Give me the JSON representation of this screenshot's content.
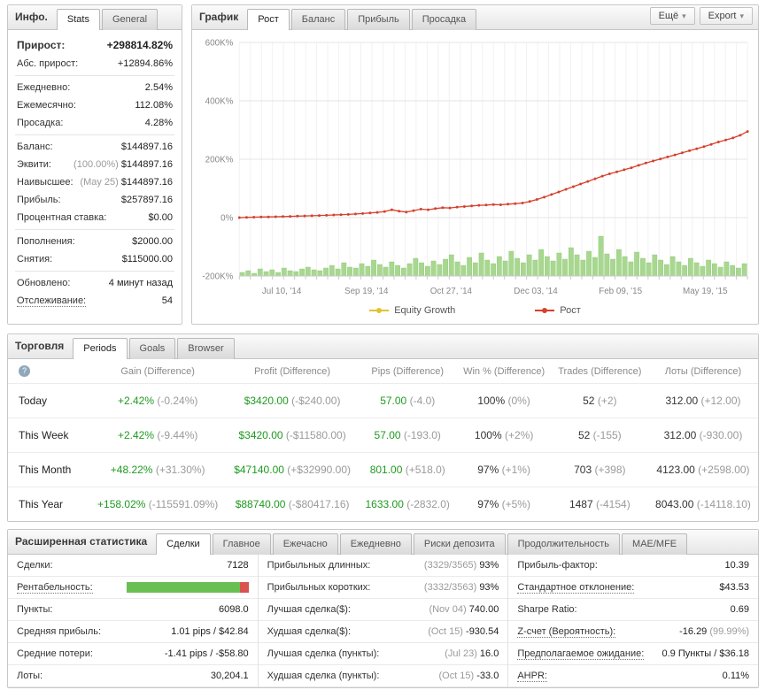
{
  "info": {
    "title": "Инфо.",
    "tabs": [
      "Stats",
      "General"
    ],
    "gain_label": "Прирост:",
    "gain_value": "+298814.82%",
    "abs_gain_label": "Абс. прирост:",
    "abs_gain_value": "+12894.86%",
    "daily_label": "Ежедневно:",
    "daily_value": "2.54%",
    "monthly_label": "Ежемесячно:",
    "monthly_value": "112.08%",
    "drawdown_label": "Просадка:",
    "drawdown_value": "4.28%",
    "balance_label": "Баланс:",
    "balance_value": "$144897.16",
    "equity_label": "Эквити:",
    "equity_pct": "(100.00%)",
    "equity_value": "$144897.16",
    "highest_label": "Наивысшее:",
    "highest_date": "(May 25)",
    "highest_value": "$144897.16",
    "profit_label": "Прибыль:",
    "profit_value": "$257897.16",
    "interest_label": "Процентная ставка:",
    "interest_value": "$0.00",
    "deposits_label": "Пополнения:",
    "deposits_value": "$2000.00",
    "withdrawals_label": "Снятия:",
    "withdrawals_value": "$115000.00",
    "updated_label": "Обновлено:",
    "updated_value": "4 минут назад",
    "tracking_label": "Отслеживание:",
    "tracking_value": "54"
  },
  "chart": {
    "title": "График",
    "tabs": [
      "Рост",
      "Баланс",
      "Прибыль",
      "Просадка"
    ],
    "more_btn": "Ещё",
    "export_btn": "Export",
    "caret": "▾",
    "legend": [
      "Equity Growth",
      "Рост"
    ]
  },
  "chart_data": {
    "type": "line",
    "title": "Рост счёта (%)",
    "xlabel": "",
    "ylabel": "",
    "ylim": [
      -200000,
      600000
    ],
    "yticks": [
      "600K%",
      "400K%",
      "200K%",
      "0%",
      "-200K%"
    ],
    "ytick_values": [
      600000,
      400000,
      200000,
      0,
      -200000
    ],
    "xticks": [
      "Jul 10, '14",
      "Sep 19, '14",
      "Oct 27, '14",
      "Dec 03, '14",
      "Feb 09, '15",
      "May 19, '15"
    ],
    "legend_position": "bottom",
    "series": [
      {
        "name": "Equity Growth",
        "color": "#e3c230",
        "values": []
      },
      {
        "name": "Рост",
        "color": "#d6402c",
        "values": [
          0,
          800,
          1500,
          2000,
          2500,
          3000,
          3500,
          4200,
          5000,
          5800,
          6500,
          7200,
          8000,
          9000,
          10000,
          11000,
          12500,
          14000,
          16000,
          18000,
          21000,
          27000,
          22000,
          19000,
          24000,
          29000,
          27000,
          31000,
          34000,
          33000,
          36000,
          38000,
          40000,
          42000,
          43000,
          45000,
          44000,
          46000,
          48000,
          50000,
          55000,
          62000,
          70000,
          79000,
          88000,
          97000,
          106000,
          115000,
          124000,
          133000,
          142000,
          150000,
          157000,
          164000,
          171000,
          179000,
          187000,
          194000,
          201000,
          208000,
          215000,
          222000,
          229000,
          236000,
          243000,
          251000,
          259000,
          266000,
          273000,
          282000,
          295000
        ]
      }
    ],
    "bars": {
      "name": "volume",
      "color": "#a8d88f",
      "values": [
        4,
        6,
        3,
        8,
        5,
        7,
        4,
        9,
        6,
        5,
        8,
        10,
        7,
        6,
        9,
        12,
        8,
        15,
        10,
        9,
        14,
        11,
        18,
        13,
        10,
        16,
        12,
        9,
        14,
        20,
        15,
        11,
        17,
        13,
        19,
        24,
        16,
        12,
        21,
        15,
        26,
        18,
        14,
        22,
        17,
        28,
        20,
        15,
        24,
        18,
        30,
        22,
        17,
        26,
        19,
        32,
        24,
        18,
        28,
        21,
        45,
        25,
        19,
        30,
        22,
        16,
        27,
        20,
        15,
        24,
        18,
        13,
        22,
        16,
        12,
        20,
        15,
        11,
        18,
        14,
        10,
        16,
        12,
        9,
        14
      ]
    }
  },
  "trading": {
    "title": "Торговля",
    "tabs": [
      "Periods",
      "Goals",
      "Browser"
    ],
    "help_icon": "?",
    "columns": [
      "Gain (Difference)",
      "Profit (Difference)",
      "Pips (Difference)",
      "Win % (Difference)",
      "Trades (Difference)",
      "Лоты (Difference)"
    ],
    "rows": [
      {
        "label": "Today",
        "gain": "+2.42%",
        "gain_diff": "(-0.24%)",
        "profit": "$3420.00",
        "profit_diff": "(-$240.00)",
        "pips": "57.00",
        "pips_diff": "(-4.0)",
        "win": "100%",
        "win_diff": "(0%)",
        "trades": "52",
        "trades_diff": "(+2)",
        "lots": "312.00",
        "lots_diff": "(+12.00)"
      },
      {
        "label": "This Week",
        "gain": "+2.42%",
        "gain_diff": "(-9.44%)",
        "profit": "$3420.00",
        "profit_diff": "(-$11580.00)",
        "pips": "57.00",
        "pips_diff": "(-193.0)",
        "win": "100%",
        "win_diff": "(+2%)",
        "trades": "52",
        "trades_diff": "(-155)",
        "lots": "312.00",
        "lots_diff": "(-930.00)"
      },
      {
        "label": "This Month",
        "gain": "+48.22%",
        "gain_diff": "(+31.30%)",
        "profit": "$47140.00",
        "profit_diff": "(+$32990.00)",
        "pips": "801.00",
        "pips_diff": "(+518.0)",
        "win": "97%",
        "win_diff": "(+1%)",
        "trades": "703",
        "trades_diff": "(+398)",
        "lots": "4123.00",
        "lots_diff": "(+2598.00)"
      },
      {
        "label": "This Year",
        "gain": "+158.02%",
        "gain_diff": "(-115591.09%)",
        "profit": "$88740.00",
        "profit_diff": "(-$80417.16)",
        "pips": "1633.00",
        "pips_diff": "(-2832.0)",
        "win": "97%",
        "win_diff": "(+5%)",
        "trades": "1487",
        "trades_diff": "(-4154)",
        "lots": "8043.00",
        "lots_diff": "(-14118.10)"
      }
    ]
  },
  "stats": {
    "title": "Расширенная статистика",
    "tabs": [
      "Сделки",
      "Главное",
      "Ежечасно",
      "Ежедневно",
      "Риски депозита",
      "Продолжительность",
      "MAE/MFE"
    ],
    "profitability_green": 93,
    "left": [
      {
        "label": "Сделки:",
        "value": "7128"
      },
      {
        "label": "Рентабельность:",
        "value": ""
      },
      {
        "label": "Пункты:",
        "value": "6098.0"
      },
      {
        "label": "Средняя прибыль:",
        "value": "1.01 pips / $42.84"
      },
      {
        "label": "Средние потери:",
        "value": "-1.41 pips / -$58.80"
      },
      {
        "label": "Лоты:",
        "value": "30,204.1"
      }
    ],
    "middle": [
      {
        "label": "Прибыльных длинных:",
        "pre": "(3329/3565)",
        "value": "93%"
      },
      {
        "label": "Прибыльных коротких:",
        "pre": "(3332/3563)",
        "value": "93%"
      },
      {
        "label": "Лучшая сделка($):",
        "pre": "(Nov 04)",
        "value": "740.00"
      },
      {
        "label": "Худшая сделка($):",
        "pre": "(Oct 15)",
        "value": "-930.54"
      },
      {
        "label": "Лучшая сделка (пункты):",
        "pre": "(Jul 23)",
        "value": "16.0"
      },
      {
        "label": "Худшая сделка (пункты):",
        "pre": "(Oct 15)",
        "value": "-33.0"
      }
    ],
    "right": [
      {
        "label": "Прибыль-фактор:",
        "value": "10.39"
      },
      {
        "label": "Стандартное отклонение:",
        "value": "$43.53"
      },
      {
        "label": "Sharpe Ratio:",
        "value": "0.69"
      },
      {
        "label": "Z-счет (Вероятность):",
        "value": "-16.29",
        "post": "(99.99%)"
      },
      {
        "label": "Предполагаемое ожидание:",
        "value": "0.9 Пункты / $36.18"
      },
      {
        "label": "AHPR:",
        "value": "0.11%"
      }
    ]
  }
}
